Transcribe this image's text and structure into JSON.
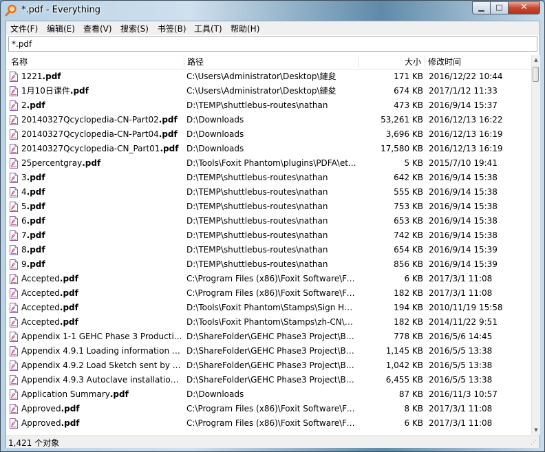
{
  "window": {
    "title": "*.pdf - Everything"
  },
  "caption_buttons": {
    "minimize": "▁",
    "maximize": "□",
    "close": "✕"
  },
  "menu": [
    {
      "label": "文件(F)"
    },
    {
      "label": "编辑(E)"
    },
    {
      "label": "查看(V)"
    },
    {
      "label": "搜索(S)"
    },
    {
      "label": "书签(B)"
    },
    {
      "label": "工具(T)"
    },
    {
      "label": "帮助(H)"
    }
  ],
  "search": {
    "value": "*.pdf"
  },
  "columns": {
    "name": "名称",
    "path": "路径",
    "size": "大小",
    "modified": "修改时间"
  },
  "rows": [
    {
      "base": "1221",
      "ext": ".pdf",
      "path": "C:\\Users\\Administrator\\Desktop\\鏈夋",
      "size": "171 KB",
      "date": "2016/12/22 10:44"
    },
    {
      "base": "1月10日课件",
      "ext": ".pdf",
      "path": "C:\\Users\\Administrator\\Desktop\\鏈夋",
      "size": "674 KB",
      "date": "2017/1/12 11:33"
    },
    {
      "base": "2",
      "ext": ".pdf",
      "path": "D:\\TEMP\\shuttlebus-routes\\nathan",
      "size": "473 KB",
      "date": "2016/9/14 15:37"
    },
    {
      "base": "20140327Qcyclopedia-CN-Part02",
      "ext": ".pdf",
      "path": "D:\\Downloads",
      "size": "53,261 KB",
      "date": "2016/12/13 16:22"
    },
    {
      "base": "20140327Qcyclopedia-CN-Part04",
      "ext": ".pdf",
      "path": "D:\\Downloads",
      "size": "3,696 KB",
      "date": "2016/12/13 16:19"
    },
    {
      "base": "20140327Qcyclopedia-CN_Part01",
      "ext": ".pdf",
      "path": "D:\\Downloads",
      "size": "17,580 KB",
      "date": "2016/12/13 16:19"
    },
    {
      "base": "25percentgray",
      "ext": ".pdf",
      "path": "D:\\Tools\\Foxit Phantom\\plugins\\PDFA\\et...",
      "size": "5 KB",
      "date": "2015/7/10 19:41"
    },
    {
      "base": "3",
      "ext": ".pdf",
      "path": "D:\\TEMP\\shuttlebus-routes\\nathan",
      "size": "642 KB",
      "date": "2016/9/14 15:38"
    },
    {
      "base": "4",
      "ext": ".pdf",
      "path": "D:\\TEMP\\shuttlebus-routes\\nathan",
      "size": "555 KB",
      "date": "2016/9/14 15:38"
    },
    {
      "base": "5",
      "ext": ".pdf",
      "path": "D:\\TEMP\\shuttlebus-routes\\nathan",
      "size": "753 KB",
      "date": "2016/9/14 15:38"
    },
    {
      "base": "6",
      "ext": ".pdf",
      "path": "D:\\TEMP\\shuttlebus-routes\\nathan",
      "size": "653 KB",
      "date": "2016/9/14 15:38"
    },
    {
      "base": "7",
      "ext": ".pdf",
      "path": "D:\\TEMP\\shuttlebus-routes\\nathan",
      "size": "742 KB",
      "date": "2016/9/14 15:38"
    },
    {
      "base": "8",
      "ext": ".pdf",
      "path": "D:\\TEMP\\shuttlebus-routes\\nathan",
      "size": "654 KB",
      "date": "2016/9/14 15:39"
    },
    {
      "base": "9",
      "ext": ".pdf",
      "path": "D:\\TEMP\\shuttlebus-routes\\nathan",
      "size": "856 KB",
      "date": "2016/9/14 15:39"
    },
    {
      "base": "Accepted",
      "ext": ".pdf",
      "path": "C:\\Program Files (x86)\\Foxit Software\\Fo...",
      "size": "6 KB",
      "date": "2017/3/1 11:08"
    },
    {
      "base": "Accepted",
      "ext": ".pdf",
      "path": "C:\\Program Files (x86)\\Foxit Software\\Fo...",
      "size": "182 KB",
      "date": "2017/3/1 11:08"
    },
    {
      "base": "Accepted",
      "ext": ".pdf",
      "path": "D:\\Tools\\Foxit Phantom\\Stamps\\Sign Here",
      "size": "194 KB",
      "date": "2010/11/19 15:58"
    },
    {
      "base": "Accepted",
      "ext": ".pdf",
      "path": "D:\\Tools\\Foxit Phantom\\Stamps\\zh-CN\\S...",
      "size": "182 KB",
      "date": "2014/11/22 9:51"
    },
    {
      "base": "Appendix 1-1 GEHC Phase 3 Producti...",
      "ext": "",
      "path": "D:\\ShareFolder\\GEHC Phase3 Project\\BD...",
      "size": "778 KB",
      "date": "2016/5/6 14:45"
    },
    {
      "base": "Appendix 4.9.1 Loading information p...",
      "ext": "",
      "path": "D:\\ShareFolder\\GEHC Phase3 Project\\BD...",
      "size": "1,145 KB",
      "date": "2016/5/5 13:38"
    },
    {
      "base": "Appendix 4.9.2 Load Sketch sent by E...",
      "ext": "",
      "path": "D:\\ShareFolder\\GEHC Phase3 Project\\BD...",
      "size": "1,042 KB",
      "date": "2016/5/5 13:38"
    },
    {
      "base": "Appendix 4.9.3 Autoclave installation ...",
      "ext": "",
      "path": "D:\\ShareFolder\\GEHC Phase3 Project\\BD...",
      "size": "6,455 KB",
      "date": "2016/5/5 13:38"
    },
    {
      "base": "Application Summary",
      "ext": ".pdf",
      "path": "D:\\Downloads",
      "size": "87 KB",
      "date": "2016/11/3 10:57"
    },
    {
      "base": "Approved",
      "ext": ".pdf",
      "path": "C:\\Program Files (x86)\\Foxit Software\\Fo...",
      "size": "8 KB",
      "date": "2017/3/1 11:08"
    },
    {
      "base": "Approved",
      "ext": ".pdf",
      "path": "C:\\Program Files (x86)\\Foxit Software\\Fo...",
      "size": "6 KB",
      "date": "2017/3/1 11:08"
    }
  ],
  "status": {
    "text": "1,421 个对象"
  },
  "icons": {
    "app": "magnifier-icon",
    "file": "pdf-file-icon",
    "accent": "#e8701a"
  }
}
